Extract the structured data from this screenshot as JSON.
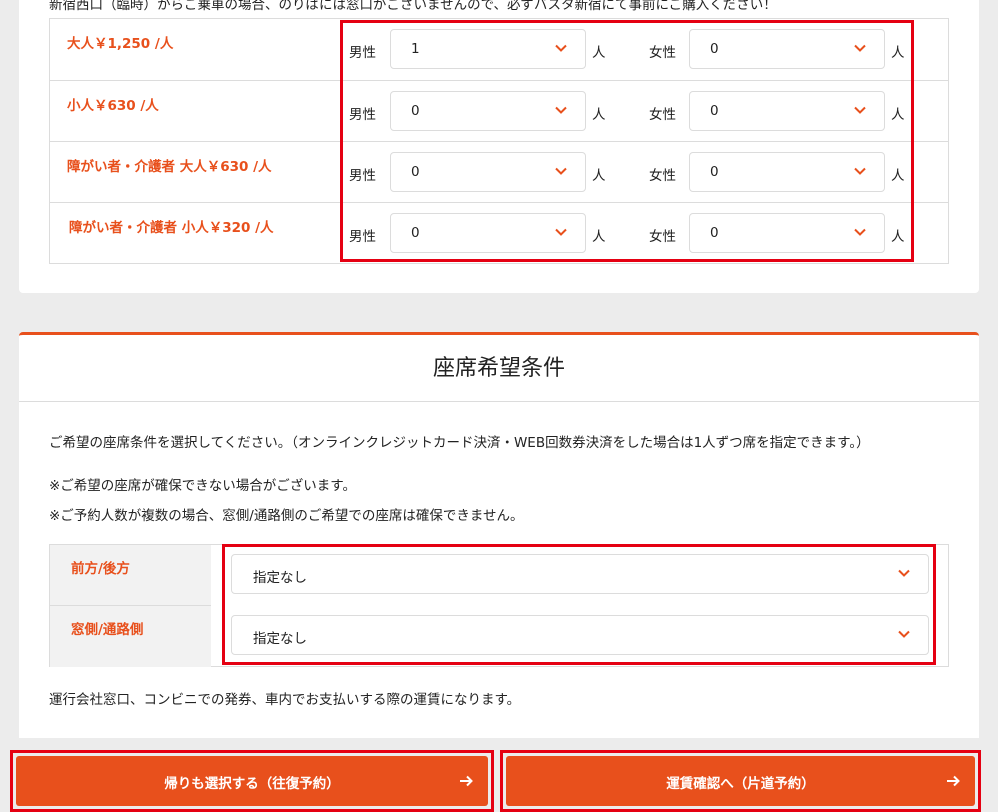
{
  "notice": "新宿西口（臨時）からご乗車の場合、のりばには窓口がございませんので、必ずバスタ新宿にて事前にご購入ください！",
  "fares": [
    {
      "label": "大人￥1,250 /人",
      "male_label": "男性",
      "male_value": "1",
      "female_label": "女性",
      "female_value": "0",
      "unit": "人"
    },
    {
      "label": "小人￥630 /人",
      "male_label": "男性",
      "male_value": "0",
      "female_label": "女性",
      "female_value": "0",
      "unit": "人"
    },
    {
      "label": "障がい者・介護者 大人￥630 /人",
      "male_label": "男性",
      "male_value": "0",
      "female_label": "女性",
      "female_value": "0",
      "unit": "人"
    },
    {
      "label": "障がい者・介護者 小人￥320 /人",
      "male_label": "男性",
      "male_value": "0",
      "female_label": "女性",
      "female_value": "0",
      "unit": "人"
    }
  ],
  "seat": {
    "title": "座席希望条件",
    "intro": "ご希望の座席条件を選択してください。（オンラインクレジットカード決済・WEB回数券決済をした場合は1人ずつ席を指定できます。）",
    "note1": "※ご希望の座席が確保できない場合がございます。",
    "note2": "※ご予約人数が複数の場合、窓側/通路側のご希望での座席は確保できません。",
    "rows": [
      {
        "label": "前方/後方",
        "value": "指定なし"
      },
      {
        "label": "窓側/通路側",
        "value": "指定なし"
      }
    ],
    "footer": "運行会社窓口、コンビニでの発券、車内でお支払いする際の運賃になります。"
  },
  "buttons": {
    "round_trip": "帰りも選択する（往復予約）",
    "one_way": "運賃確認へ（片道予約）"
  },
  "colors": {
    "accent": "#e8501c",
    "highlight": "#e50012"
  }
}
